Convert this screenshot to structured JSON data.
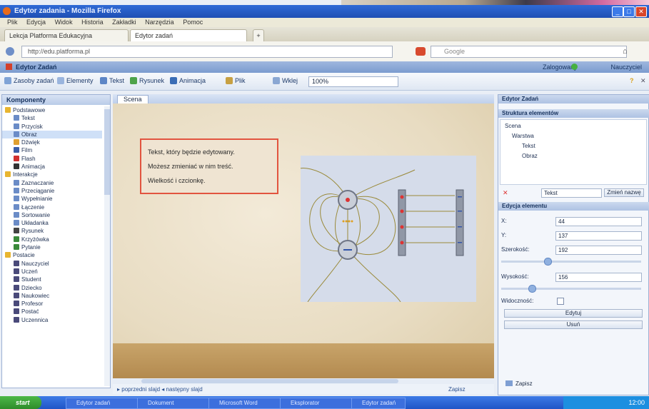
{
  "window": {
    "title": "Edytor zadania - Mozilla Firefox",
    "controls": [
      "_",
      "□",
      "✕"
    ]
  },
  "menu": [
    "Plik",
    "Edycja",
    "Widok",
    "Historia",
    "Zakładki",
    "Narzędzia",
    "Pomoc"
  ],
  "tabs": [
    {
      "label": "Lekcja Platforma Edukacyjna"
    },
    {
      "label": "Edytor zadań"
    }
  ],
  "tab_new": "+",
  "address": {
    "url": "http://edu.platforma.pl",
    "search_placeholder": "Google"
  },
  "app": {
    "title": "Edytor Zadań",
    "user_label": "Zalogowany",
    "user_name": "Nauczyciel"
  },
  "toolbar": {
    "items": [
      "Zasoby zadań",
      "Elementy",
      "Tekst",
      "Rysunek",
      "Animacja",
      "Plik",
      "Wklej"
    ],
    "zoom": "100%",
    "help": "?",
    "close": "✕"
  },
  "left_panel": {
    "header": "Komponenty",
    "tree": [
      {
        "label": "Podstawowe",
        "level": 0,
        "icon": "#e8b530"
      },
      {
        "label": "Tekst",
        "level": 1,
        "icon": "#6b8cc7"
      },
      {
        "label": "Przycisk",
        "level": 1,
        "icon": "#6b8cc7"
      },
      {
        "label": "Obraz",
        "level": 1,
        "icon": "#6b8cc7",
        "selected": true
      },
      {
        "label": "Dźwięk",
        "level": 1,
        "icon": "#e0a030"
      },
      {
        "label": "Film",
        "level": 1,
        "icon": "#3a5ea8"
      },
      {
        "label": "Flash",
        "level": 1,
        "icon": "#d03030"
      },
      {
        "label": "Animacja",
        "level": 1,
        "icon": "#333"
      },
      {
        "label": "Interakcje",
        "level": 0,
        "icon": "#e8b530"
      },
      {
        "label": "Zaznaczanie",
        "level": 1,
        "icon": "#6b8cc7"
      },
      {
        "label": "Przeciąganie",
        "level": 1,
        "icon": "#6b8cc7"
      },
      {
        "label": "Wypełnianie",
        "level": 1,
        "icon": "#6b8cc7"
      },
      {
        "label": "Łączenie",
        "level": 1,
        "icon": "#6b8cc7"
      },
      {
        "label": "Sortowanie",
        "level": 1,
        "icon": "#6b8cc7"
      },
      {
        "label": "Układanka",
        "level": 1,
        "icon": "#6b8cc7"
      },
      {
        "label": "Rysunek",
        "level": 1,
        "icon": "#444"
      },
      {
        "label": "Krzyżówka",
        "level": 1,
        "icon": "#3a8a3a"
      },
      {
        "label": "Pytanie",
        "level": 1,
        "icon": "#3a8a3a"
      },
      {
        "label": "Postacie",
        "level": 0,
        "icon": "#e8b530"
      },
      {
        "label": "Nauczyciel",
        "level": 1,
        "icon": "#4a4a7a"
      },
      {
        "label": "Uczeń",
        "level": 1,
        "icon": "#4a4a7a"
      },
      {
        "label": "Student",
        "level": 1,
        "icon": "#4a4a7a"
      },
      {
        "label": "Dziecko",
        "level": 1,
        "icon": "#4a4a7a"
      },
      {
        "label": "Naukowiec",
        "level": 1,
        "icon": "#4a4a7a"
      },
      {
        "label": "Profesor",
        "level": 1,
        "icon": "#4a4a7a"
      },
      {
        "label": "Postać",
        "level": 1,
        "icon": "#4a4a7a"
      },
      {
        "label": "Uczennica",
        "level": 1,
        "icon": "#4a4a7a"
      }
    ]
  },
  "stage": {
    "tab": "Scena",
    "text_lines": [
      "Tekst, który będzie edytowany.",
      "Możesz zmieniać w nim treść.",
      "Wielkość i czcionkę."
    ],
    "status_left": "▸ poprzedni slajd ◂ następny slajd",
    "status_right": "Zapisz"
  },
  "right_panel": {
    "header": "Edytor Zadań",
    "structure_header": "Struktura elementów",
    "tree": [
      "Scena",
      "Warstwa",
      "Tekst",
      "Obraz"
    ],
    "name_field": "Tekst",
    "name_button": "Zmień nazwę",
    "props_header": "Edycja elementu",
    "props": [
      {
        "label": "X:",
        "value": "44"
      },
      {
        "label": "Y:",
        "value": "137"
      },
      {
        "label": "Szerokość:",
        "value": "192"
      },
      {
        "label": "Wysokość:",
        "value": "156"
      }
    ],
    "visible_label": "Widoczność:",
    "buttons": [
      "Edytuj",
      "Usuń"
    ],
    "footer": "Zapisz"
  },
  "taskbar": {
    "start": "start",
    "tasks": [
      "Edytor zadań",
      "Dokument",
      "Microsoft Word",
      "Eksplorator",
      "Edytor zadań"
    ],
    "tray_time": "12:00"
  }
}
